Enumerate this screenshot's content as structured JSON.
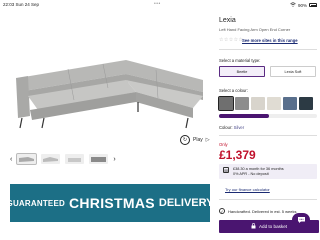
{
  "status_bar": {
    "time": "22:03  Sun 24 Sep",
    "battery": "90%"
  },
  "product": {
    "title": "Lexia",
    "subtitle": "Left Hand Facing Arm Open End Corner",
    "reviews_link": "See more sites in this range"
  },
  "gallery": {
    "play_label": "Play"
  },
  "banner": {
    "word1": "GUARANTEED",
    "word2": "CHRISTMAS",
    "word3": "DELIVERY"
  },
  "material": {
    "label": "Select a material type:",
    "options": [
      "Beetle",
      "Lexia Soft"
    ]
  },
  "colour": {
    "label": "Select a colour:",
    "swatches": [
      "#6f6f6f",
      "#8d8d8d",
      "#d8d4cc",
      "#e0dcd3",
      "#596f8c",
      "#2c3a44",
      "#8a8c7e"
    ],
    "current_label": "Colour:",
    "current_value": "Silver"
  },
  "pricing": {
    "only_label": "Only",
    "price": "£1,379",
    "finance_line1": "£38.30 a month for 36 months",
    "finance_line2": "0% APR - No deposit",
    "finance_link": "Try our finance calculator"
  },
  "delivery": {
    "text": "Handcrafted. Delivered in est. 5 weeks"
  },
  "cta": {
    "basket": "Add to basket"
  },
  "colors": {
    "brand": "#4a1570",
    "price": "#c0102b",
    "banner": "#1c6f86"
  }
}
